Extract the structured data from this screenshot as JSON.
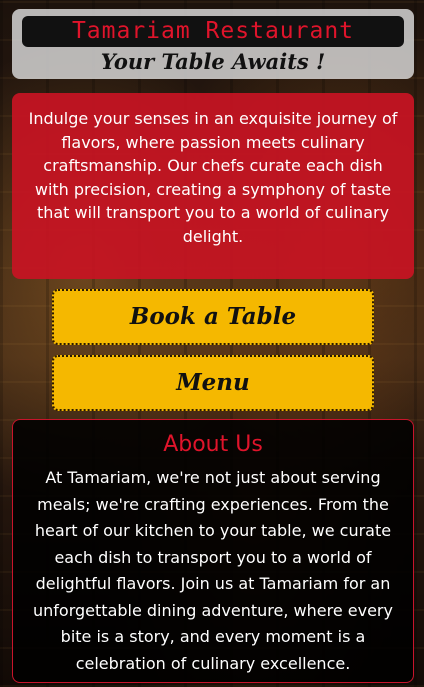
{
  "header": {
    "title": "Tamariam Restaurant",
    "tagline": "Your Table Awaits !"
  },
  "intro": {
    "text": "Indulge your senses in an exquisite journey of flavors, where passion meets culinary craftsmanship. Our chefs curate each dish with precision, creating a symphony of taste that will transport you to a world of culinary delight."
  },
  "buttons": {
    "book_label": "Book a Table",
    "menu_label": "Menu"
  },
  "about": {
    "heading": "About Us",
    "text": "At Tamariam, we're not just about serving meals; we're crafting experiences. From the heart of our kitchen to your table, we curate each dish to transport you to a world of delightful flavors. Join us at Tamariam for an unforgettable dining adventure, where every bite is a story, and every moment is a celebration of culinary excellence."
  },
  "colors": {
    "brand_red": "#e0142b",
    "panel_red": "#c8142b",
    "button_gold": "#f5b800"
  }
}
